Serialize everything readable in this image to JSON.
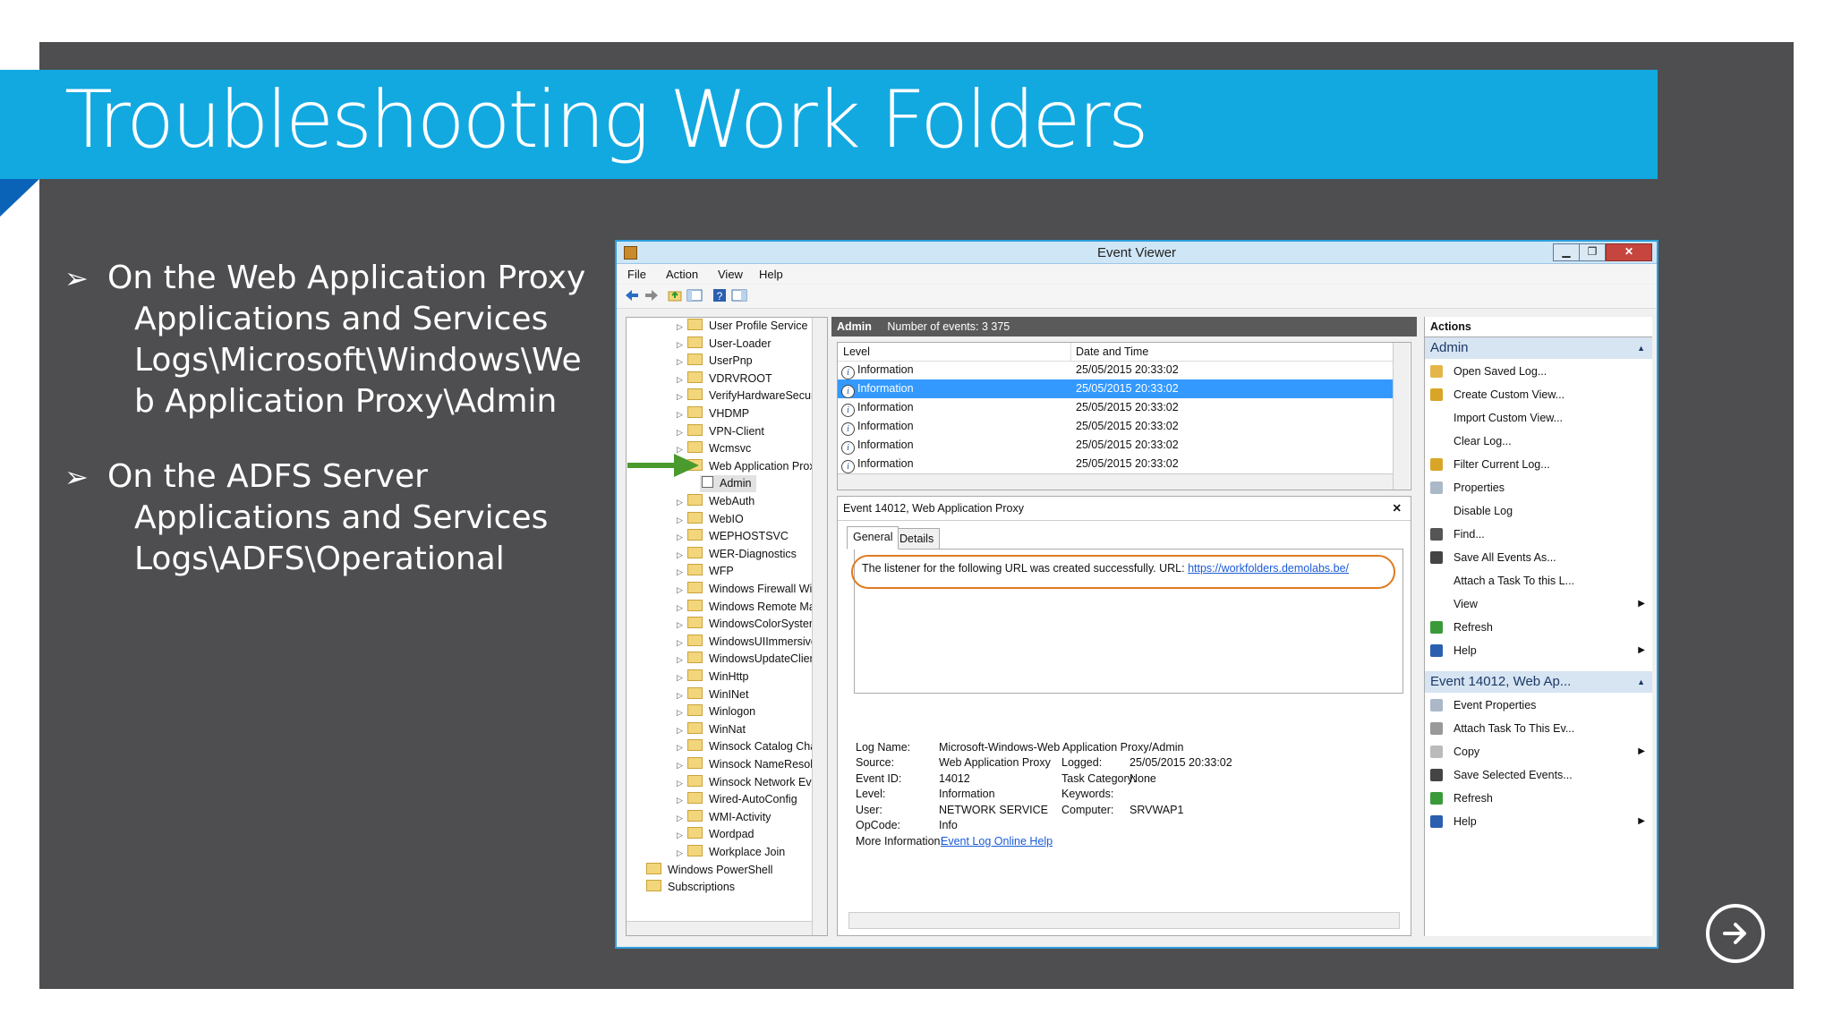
{
  "slide": {
    "title": "Troubleshooting Work Folders",
    "bullets": [
      {
        "lines": [
          "On the Web Application Proxy",
          "Applications and Services",
          "Logs\\Microsoft\\Windows\\We",
          "b Application Proxy\\Admin"
        ]
      },
      {
        "lines": [
          "On the ADFS Server",
          "Applications and Services",
          "Logs\\ADFS\\Operational"
        ]
      }
    ],
    "bullet_glyph": "➢",
    "next_icon": "arrow-right-circle-icon"
  },
  "window": {
    "title": "Event Viewer",
    "controls": {
      "minimize": "▁",
      "maximize": "❐",
      "close": "✕"
    },
    "menu": [
      "File",
      "Action",
      "View",
      "Help"
    ]
  },
  "tree": {
    "items": [
      "User Profile Service",
      "User-Loader",
      "UserPnp",
      "VDRVROOT",
      "VerifyHardwareSecurity",
      "VHDMP",
      "VPN-Client",
      "Wcmsvc",
      "Web Application Proxy",
      "Admin",
      "WebAuth",
      "WebIO",
      "WEPHOSTSVC",
      "WER-Diagnostics",
      "WFP",
      "Windows Firewall With Ad",
      "Windows Remote Manage",
      "WindowsColorSystem",
      "WindowsUIImmersive",
      "WindowsUpdateClient",
      "WinHttp",
      "WinINet",
      "Winlogon",
      "WinNat",
      "Winsock Catalog Change",
      "Winsock NameResolution",
      "Winsock Network Event",
      "Wired-AutoConfig",
      "WMI-Activity",
      "Wordpad",
      "Workplace Join",
      "Windows PowerShell",
      "Subscriptions"
    ]
  },
  "log": {
    "name": "Admin",
    "count_label": "Number of events: 3 375",
    "columns": [
      "Level",
      "Date and Time"
    ],
    "rows": [
      {
        "level": "Information",
        "date": "25/05/2015 20:33:02"
      },
      {
        "level": "Information",
        "date": "25/05/2015 20:33:02",
        "selected": true
      },
      {
        "level": "Information",
        "date": "25/05/2015 20:33:02"
      },
      {
        "level": "Information",
        "date": "25/05/2015 20:33:02"
      },
      {
        "level": "Information",
        "date": "25/05/2015 20:33:02"
      },
      {
        "level": "Information",
        "date": "25/05/2015 20:33:02"
      }
    ]
  },
  "detail": {
    "header": "Event 14012, Web Application Proxy",
    "tabs": [
      "General",
      "Details"
    ],
    "message": "The listener for the following URL was created successfully. URL:",
    "url": "https://workfolders.demolabs.be/",
    "fields": {
      "log_name_label": "Log Name:",
      "log_name": "Microsoft-Windows-Web Application Proxy/Admin",
      "source_label": "Source:",
      "source": "Web Application Proxy",
      "logged_label": "Logged:",
      "logged": "25/05/2015 20:33:02",
      "event_id_label": "Event ID:",
      "event_id": "14012",
      "task_label": "Task Category:",
      "task": "None",
      "level_label": "Level:",
      "level": "Information",
      "keywords_label": "Keywords:",
      "keywords": "",
      "user_label": "User:",
      "user": "NETWORK SERVICE",
      "computer_label": "Computer:",
      "computer": "SRVWAP1",
      "opcode_label": "OpCode:",
      "opcode": "Info",
      "more_label": "More Information:",
      "more_link": "Event Log Online Help"
    }
  },
  "actions": {
    "header": "Actions",
    "section1": "Admin",
    "items1": [
      "Open Saved Log...",
      "Create Custom View...",
      "Import Custom View...",
      "Clear Log...",
      "Filter Current Log...",
      "Properties",
      "Disable Log",
      "Find...",
      "Save All Events As...",
      "Attach a Task To this L...",
      "View",
      "Refresh",
      "Help"
    ],
    "section2": "Event 14012, Web Ap...",
    "items2": [
      "Event Properties",
      "Attach Task To This Ev...",
      "Copy",
      "Save Selected Events...",
      "Refresh",
      "Help"
    ]
  },
  "colors": {
    "title_bar": "#12a9e1",
    "slide_bg": "#4e4e50",
    "highlight_oval": "#e07a1f",
    "selection": "#3399ff"
  }
}
